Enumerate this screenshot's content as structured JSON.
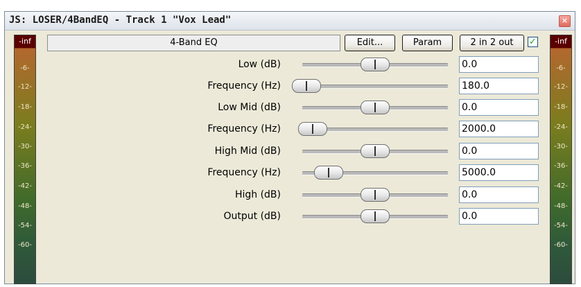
{
  "window": {
    "title": "JS: LOSER/4BandEQ - Track 1 \"Vox Lead\"",
    "close_glyph": "×"
  },
  "header": {
    "name": "4-Band EQ",
    "edit_label": "Edit...",
    "param_label": "Param",
    "io_label": "2 in 2 out",
    "bypass_checked_glyph": "✓"
  },
  "meters": {
    "top_label": "-inf",
    "ticks": [
      "-6-",
      "-12-",
      "-18-",
      "-24-",
      "-30-",
      "-36-",
      "-42-",
      "-48-",
      "-54-",
      "-60-"
    ]
  },
  "params": [
    {
      "label": "Low (dB)",
      "value": "0.0",
      "level": 0.5
    },
    {
      "label": "Frequency (Hz)",
      "value": "180.0",
      "level": 0.03
    },
    {
      "label": "Low Mid (dB)",
      "value": "0.0",
      "level": 0.5
    },
    {
      "label": "Frequency (Hz)",
      "value": "2000.0",
      "level": 0.07
    },
    {
      "label": "High Mid (dB)",
      "value": "0.0",
      "level": 0.5
    },
    {
      "label": "Frequency (Hz)",
      "value": "5000.0",
      "level": 0.18
    },
    {
      "label": "High (dB)",
      "value": "0.0",
      "level": 0.5
    },
    {
      "label": "Output (dB)",
      "value": "0.0",
      "level": 0.5
    }
  ]
}
